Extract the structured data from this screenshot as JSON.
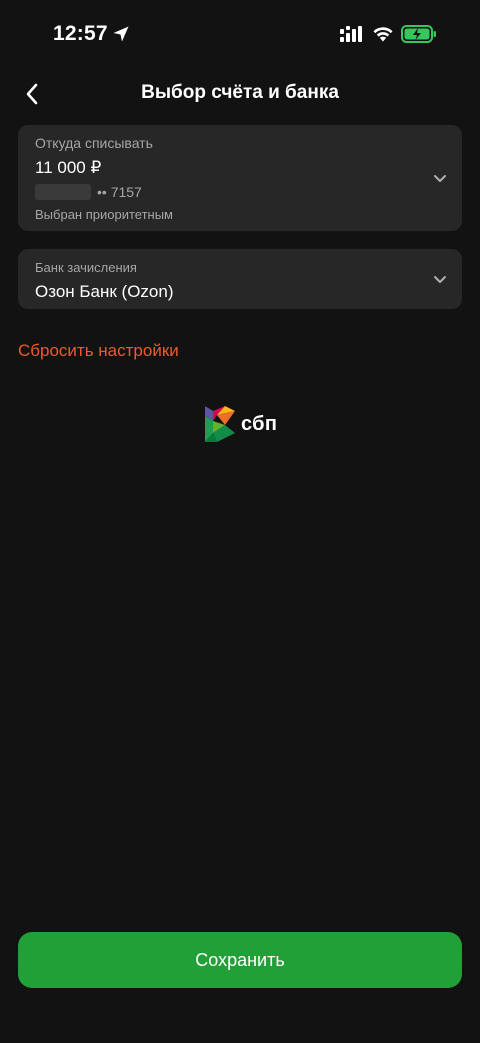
{
  "status_bar": {
    "time": "12:57"
  },
  "nav": {
    "title": "Выбор счёта и банка"
  },
  "from_card": {
    "label": "Откуда списывать",
    "amount": "11 000 ₽",
    "account_suffix": "•• 7157",
    "note": "Выбран приоритетным"
  },
  "bank_card": {
    "label": "Банк зачисления",
    "value": "Озон Банк (Ozon)"
  },
  "reset_label": "Сбросить настройки",
  "sbp": {
    "text": "сбп"
  },
  "save_label": "Сохранить",
  "colors": {
    "background": "#121212",
    "card": "#272727",
    "accent_reset": "#ec5b2c",
    "primary_button": "#21a038",
    "battery_fill": "#34c759"
  }
}
